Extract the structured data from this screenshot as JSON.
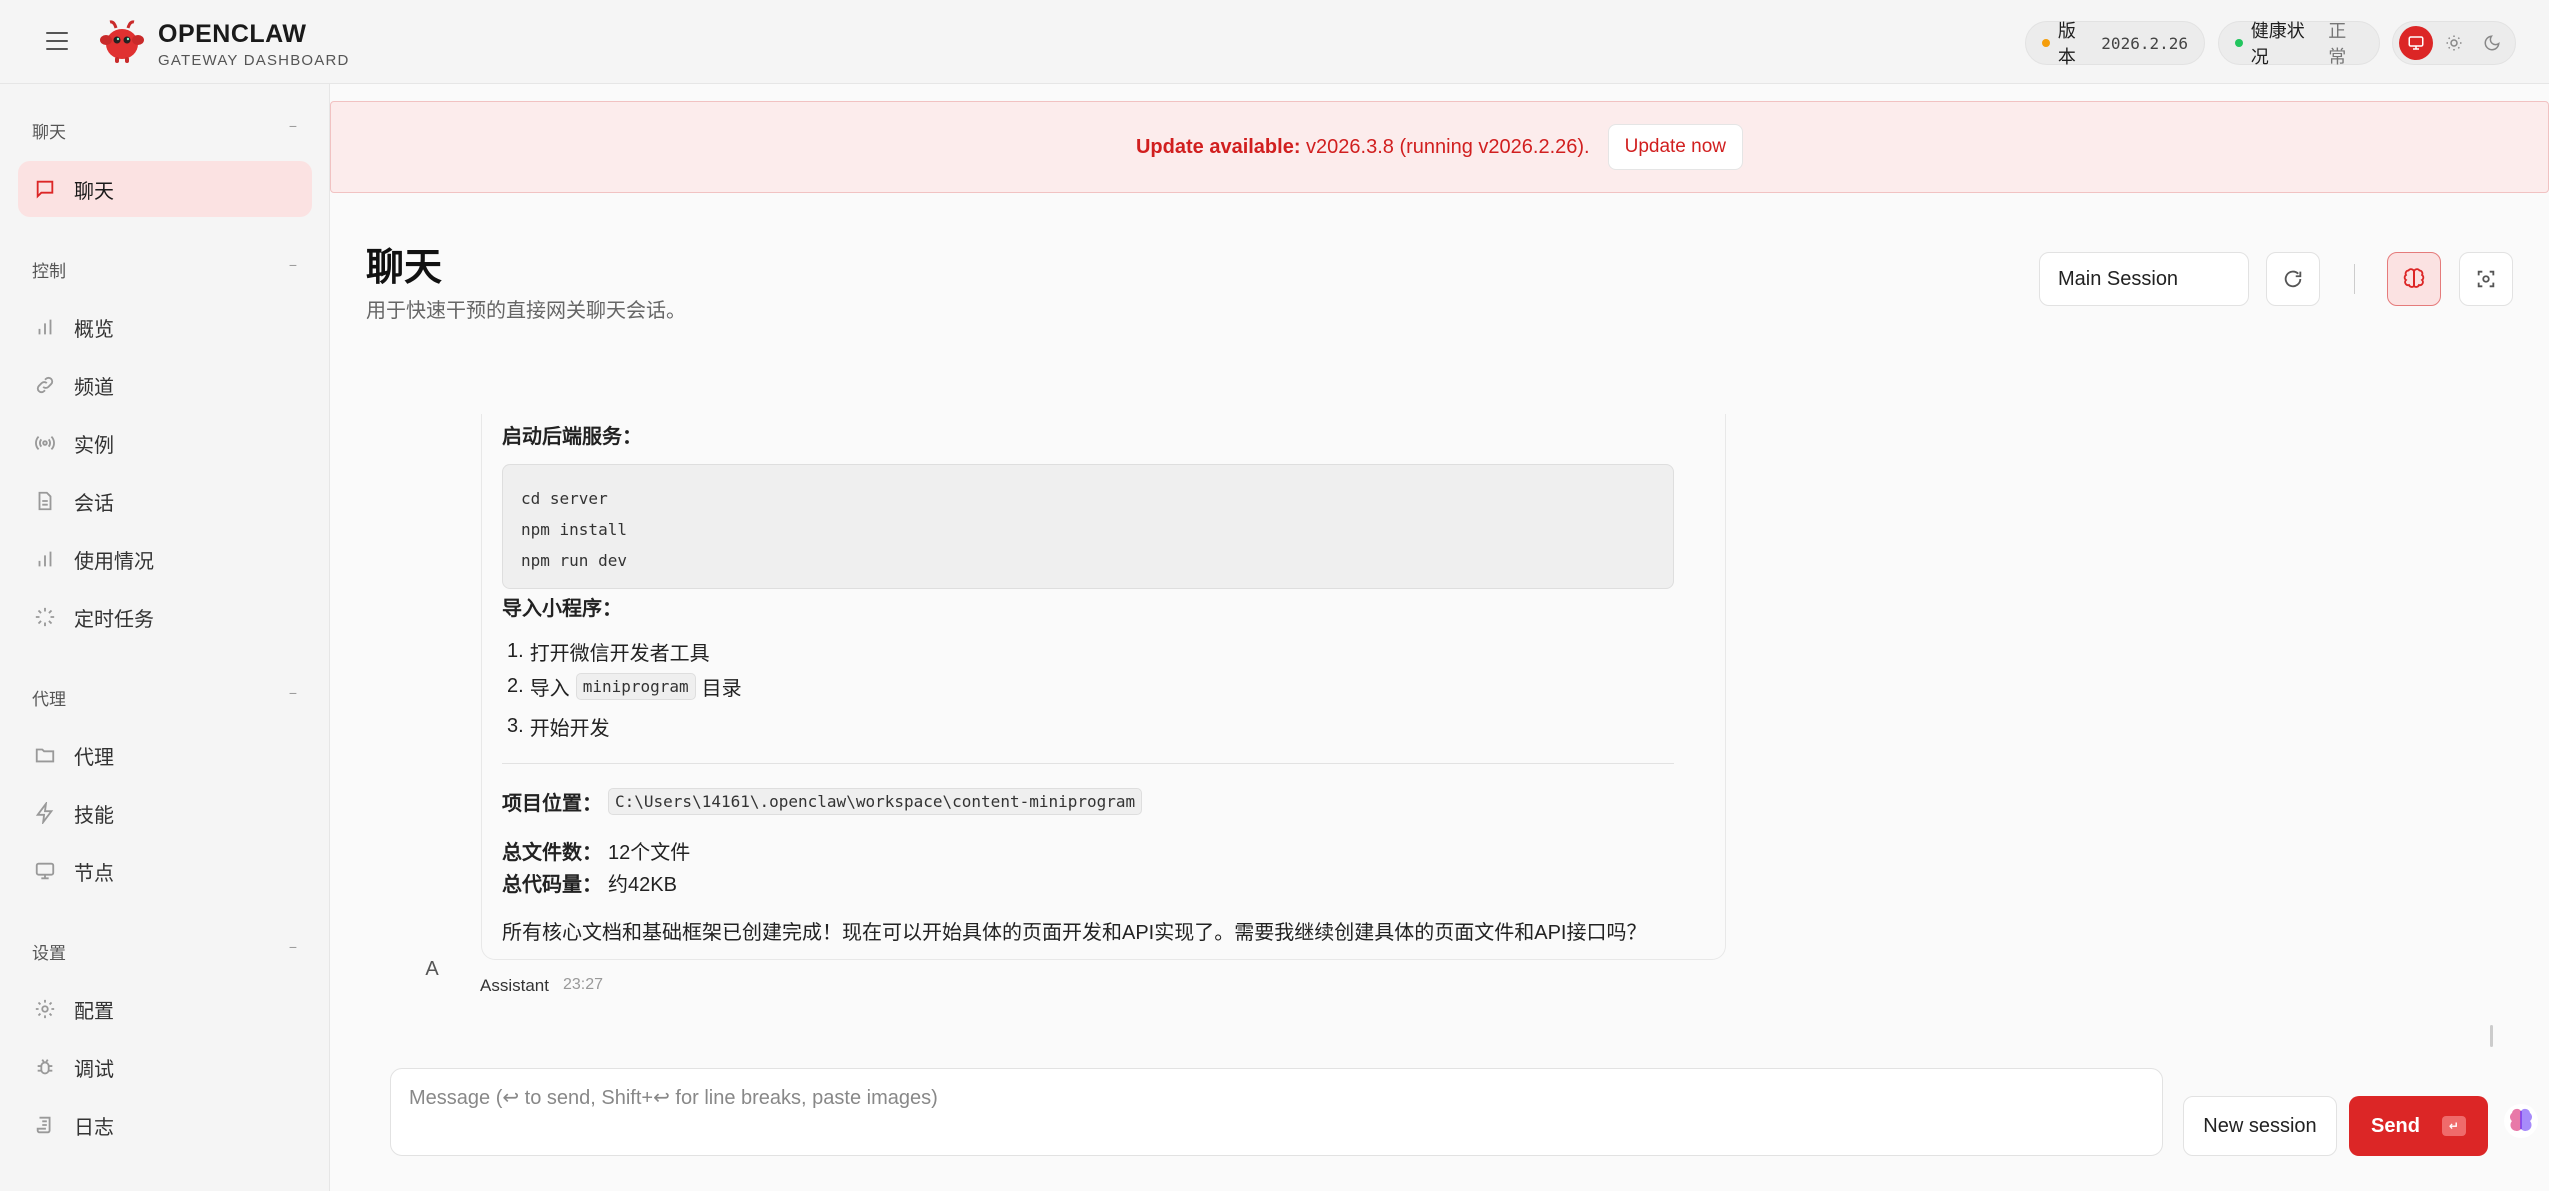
{
  "header": {
    "brand_name": "OPENCLAW",
    "brand_sub": "GATEWAY DASHBOARD",
    "version_label": "版本",
    "version_value": "2026.2.26",
    "health_label": "健康状况",
    "health_value": "正常",
    "colors": {
      "version_dot": "#f59e0b",
      "health_dot": "#22c55e",
      "accent": "#dc2626"
    }
  },
  "sidebar": {
    "sections": [
      {
        "title": "聊天",
        "items": [
          {
            "label": "聊天",
            "icon": "chat-bubble-icon",
            "active": true
          }
        ]
      },
      {
        "title": "控制",
        "items": [
          {
            "label": "概览",
            "icon": "bar-chart-icon"
          },
          {
            "label": "频道",
            "icon": "link-icon"
          },
          {
            "label": "实例",
            "icon": "broadcast-icon"
          },
          {
            "label": "会话",
            "icon": "document-icon"
          },
          {
            "label": "使用情况",
            "icon": "bar-chart-icon"
          },
          {
            "label": "定时任务",
            "icon": "loader-icon"
          }
        ]
      },
      {
        "title": "代理",
        "items": [
          {
            "label": "代理",
            "icon": "folder-icon"
          },
          {
            "label": "技能",
            "icon": "lightning-icon"
          },
          {
            "label": "节点",
            "icon": "monitor-icon"
          }
        ]
      },
      {
        "title": "设置",
        "items": [
          {
            "label": "配置",
            "icon": "gear-icon"
          },
          {
            "label": "调试",
            "icon": "bug-icon"
          },
          {
            "label": "日志",
            "icon": "scroll-icon"
          }
        ]
      }
    ]
  },
  "banner": {
    "prefix": "Update available:",
    "text": " v2026.3.8 (running v2026.2.26).",
    "button": "Update now"
  },
  "page": {
    "title": "聊天",
    "subtitle": "用于快速干预的直接网关聊天会话。",
    "session_select": "Main Session"
  },
  "message": {
    "backend_heading": "启动后端服务：",
    "code_lines": [
      "cd server",
      "npm install",
      "npm run dev"
    ],
    "import_heading": "导入小程序：",
    "steps": [
      {
        "num": "1.",
        "before": "打开微信开发者工具",
        "code": "",
        "after": ""
      },
      {
        "num": "2.",
        "before": "导入",
        "code": "miniprogram",
        "after": "目录"
      },
      {
        "num": "3.",
        "before": "开始开发",
        "code": "",
        "after": ""
      }
    ],
    "location_label": "项目位置：",
    "location_value": "C:\\Users\\14161\\.openclaw\\workspace\\content-miniprogram",
    "files_label": "总文件数：",
    "files_value": "12个文件",
    "code_label": "总代码量：",
    "code_value": "约42KB",
    "closing": "所有核心文档和基础框架已创建完成！现在可以开始具体的页面开发和API实现了。需要我继续创建具体的页面文件和API接口吗？",
    "avatar": "A",
    "sender": "Assistant",
    "time": "23:27"
  },
  "composer": {
    "placeholder": "Message (↩ to send, Shift+↩ for line breaks, paste images)",
    "new_session": "New session",
    "send": "Send",
    "send_kbd": "↵"
  }
}
